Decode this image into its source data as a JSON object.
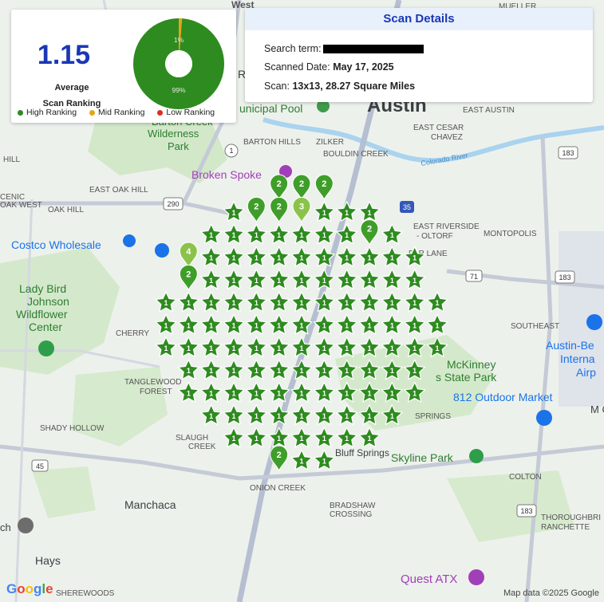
{
  "summary": {
    "average_value": "1.15",
    "average_label_line1": "Average",
    "average_label_line2": "Scan Ranking",
    "donut_top_label": "1%",
    "donut_bottom_label": "99%",
    "high_share_percent": 99,
    "mid_share_percent": 1,
    "legend": [
      {
        "label": "High Ranking",
        "color": "#2e8b1f"
      },
      {
        "label": "Mid Ranking",
        "color": "#e4a617"
      },
      {
        "label": "Low Ranking",
        "color": "#e02b20"
      }
    ]
  },
  "details": {
    "title": "Scan Details",
    "search_term_label": "Search term:",
    "scanned_date_label": "Scanned Date:",
    "scanned_date_value": "May 17, 2025",
    "scan_label": "Scan:",
    "scan_value": "13x13, 28.27 Square Miles"
  },
  "map_labels": {
    "austin": "Austin",
    "west": "West",
    "mueller": "MUELLER",
    "east_austin": "EAST AUSTIN",
    "municipal_pool": "unicipal Pool",
    "barton_creek_wilderness": [
      "Barton Creek",
      "Wilderness",
      "Park"
    ],
    "barton_hills": "BARTON HILLS",
    "zilker": "ZILKER",
    "bouldin_creek": "BOULDIN CREEK",
    "east_cesar_chavez": [
      "EAST CESAR",
      "CHAVEZ"
    ],
    "colorado_river": "Colorado River",
    "broken_spoke": "Broken Spoke",
    "east_oak_hill": "EAST OAK HILL",
    "oak_hill": "OAK HILL",
    "oak_hill_west": "OAK WEST",
    "scenic": "CENIC",
    "hill": "HILL",
    "costco": "Costco Wholesale",
    "east_riverside": [
      "EAST RIVERSIDE",
      "- OLTORF"
    ],
    "montopolis": "MONTOPOLIS",
    "par_lane": "PAR LANE",
    "lady_bird": [
      "Lady Bird",
      "Johnson",
      "Wildflower",
      "Center"
    ],
    "cherry": "CHERRY",
    "tanglewood": [
      "TANGLEWOOD",
      "FOREST"
    ],
    "southeast": "SOUTHEAST",
    "austin_bergstrom": [
      "Austin-Be",
      "Interna",
      "Airp"
    ],
    "mckinney": [
      "McKinney",
      "s State Park"
    ],
    "outdoor_market": "812 Outdoor Market",
    "shady_hollow": "SHADY HOLLOW",
    "slaughter_creek": [
      "SLAUGH",
      "CREEK"
    ],
    "springs": "SPRINGS",
    "skyline_park": "Skyline Park",
    "colton": "COLTON",
    "onion_creek": "ONION CREEK",
    "manchaca": "Manchaca",
    "bradshaw": [
      "BRADSHAW",
      "CROSSING"
    ],
    "thoroughbred": [
      "THOROUGHBRI",
      "RANCHETTE"
    ],
    "hays": "Hays",
    "sherewoods": "SHEREWOODS",
    "quest_atx": "Quest ATX",
    "bluff_springs": "Bluff Springs",
    "ch": "ch",
    "mc": "M C",
    "r": "R",
    "k": "K",
    "shields": {
      "s290": "290",
      "s1": "1",
      "s35": "35",
      "s71": "71",
      "s183a": "183",
      "s183b": "183",
      "s183c": "183",
      "s45": "45"
    }
  },
  "footer": {
    "copyright": "Map data ©2025 Google",
    "logo": "Google"
  },
  "scan_grid": {
    "rows": 13,
    "cols": 13,
    "colors": {
      "high": "#2e8b1f",
      "mid": "#8bc34a",
      "pin_high": "#3f9e2a"
    },
    "pins": [
      {
        "row": 0,
        "col": 3,
        "rank": "3",
        "color": "mid"
      },
      {
        "row": 0,
        "col": 5,
        "rank": "2",
        "color": "pin_high"
      },
      {
        "row": 0,
        "col": 6,
        "rank": "2",
        "color": "pin_high"
      },
      {
        "row": 0,
        "col": 7,
        "rank": "2",
        "color": "pin_high"
      },
      {
        "row": 1,
        "col": 4,
        "rank": "2",
        "color": "pin_high"
      },
      {
        "row": 1,
        "col": 5,
        "rank": "2",
        "color": "pin_high"
      },
      {
        "row": 1,
        "col": 6,
        "rank": "3",
        "color": "mid"
      },
      {
        "row": 2,
        "col": 9,
        "rank": "2",
        "color": "pin_high"
      },
      {
        "row": 3,
        "col": 0,
        "rank": "2",
        "color": "pin_high"
      },
      {
        "row": 3,
        "col": 1,
        "rank": "4",
        "color": "mid"
      },
      {
        "row": 4,
        "col": 1,
        "rank": "2",
        "color": "pin_high"
      },
      {
        "row": 10,
        "col": 0,
        "rank": "2",
        "color": "pin_high"
      },
      {
        "row": 11,
        "col": 1,
        "rank": "2",
        "color": "pin_high"
      },
      {
        "row": 12,
        "col": 4,
        "rank": "3",
        "color": "mid"
      },
      {
        "row": 12,
        "col": 5,
        "rank": "2",
        "color": "pin_high"
      }
    ],
    "star_rank": "1"
  }
}
